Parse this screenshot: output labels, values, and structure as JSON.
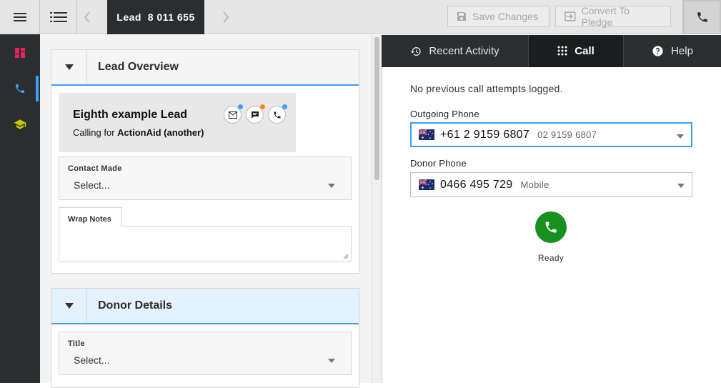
{
  "topbar": {
    "lead_label": "Lead  8 011 655",
    "save_label": "Save Changes",
    "convert_label": "Convert To Pledge"
  },
  "lead_overview": {
    "title": "Lead Overview",
    "lead_name": "Eighth example Lead",
    "calling_for_prefix": "Calling for",
    "calling_for_org": "ActionAid (another)",
    "contact_made_label": "Contact Made",
    "contact_made_value": "Select...",
    "wrap_notes_label": "Wrap Notes",
    "wrap_notes_value": ""
  },
  "donor_details": {
    "title": "Donor Details",
    "title_field_label": "Title",
    "title_field_value": "Select..."
  },
  "right_tabs": [
    {
      "label": "Recent Activity",
      "icon": "history-icon"
    },
    {
      "label": "Call",
      "icon": "dialpad-icon"
    },
    {
      "label": "Help",
      "icon": "help-icon"
    }
  ],
  "call_panel": {
    "no_previous": "No previous call attempts logged.",
    "outgoing_label": "Outgoing Phone",
    "outgoing_number": "+61 2 9159 6807",
    "outgoing_sub": "02 9159 6807",
    "donor_label": "Donor Phone",
    "donor_number": "0466 495 729",
    "donor_sub": "Mobile",
    "status": "Ready"
  },
  "colors": {
    "accent": "#3aa0ff",
    "call_green": "#17901f",
    "dark": "#2b2d2f",
    "email_dot": "#3aa0ff",
    "sms_dot": "#ff8a00",
    "phone_dot": "#3aa0ff"
  }
}
